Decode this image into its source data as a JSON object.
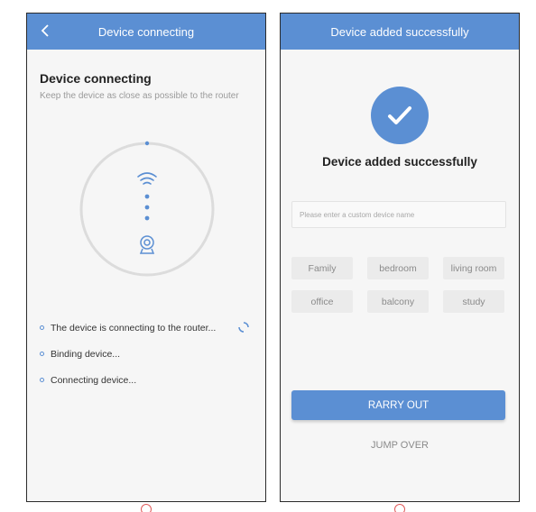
{
  "left_screen": {
    "topbar": {
      "title": "Device connecting"
    },
    "heading": "Device connecting",
    "subtitle": "Keep the device as close as possible to the router",
    "steps": [
      {
        "label": "The device is connecting to the router..."
      },
      {
        "label": "Binding device..."
      },
      {
        "label": "Connecting device..."
      }
    ]
  },
  "right_screen": {
    "topbar": {
      "title": "Device added successfully"
    },
    "heading": "Device added successfully",
    "name_input": {
      "value": "",
      "placeholder": "Please enter a custom device name"
    },
    "chips": [
      {
        "label": "Family"
      },
      {
        "label": "bedroom"
      },
      {
        "label": "living room"
      },
      {
        "label": "office"
      },
      {
        "label": "balcony"
      },
      {
        "label": "study"
      }
    ],
    "primary_button": "RARRY OUT",
    "skip_button": "JUMP OVER"
  },
  "colors": {
    "accent": "#5b8fd3",
    "ring": "#dcdcdc",
    "mark": "#e05a5a"
  },
  "icons": [
    "back-arrow-icon",
    "wifi-icon",
    "camera-icon",
    "loading-spinner-icon",
    "checkmark-icon"
  ]
}
